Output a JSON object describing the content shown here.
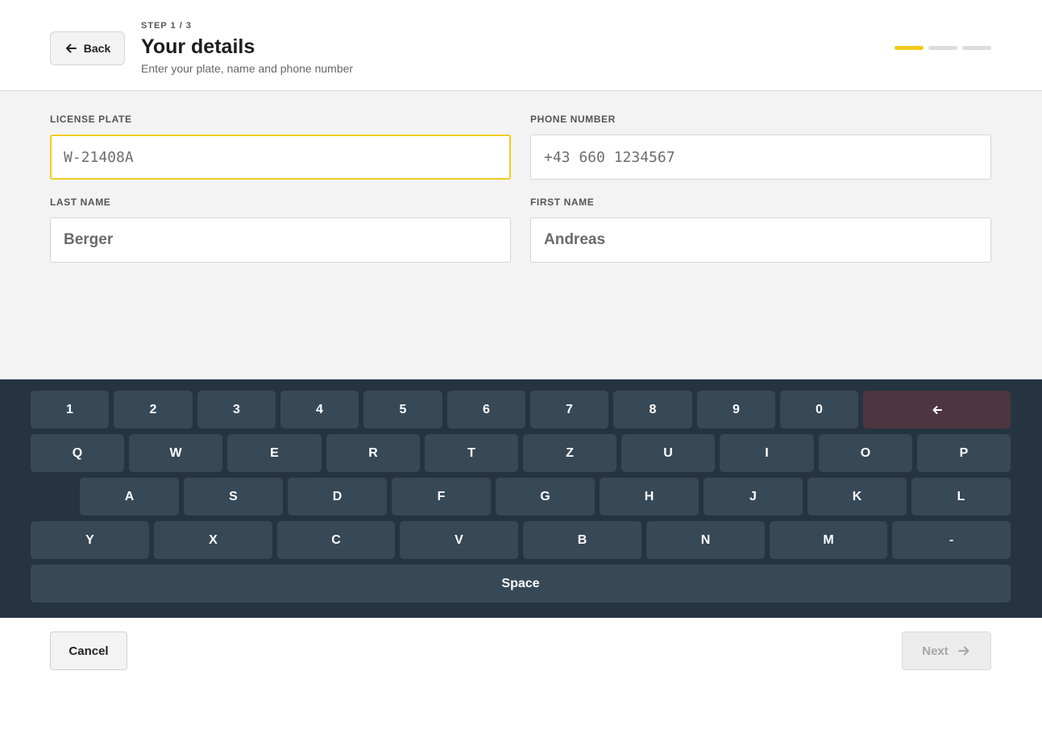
{
  "header": {
    "back_label": "Back",
    "step": "STEP 1 / 3",
    "title": "Your details",
    "subtitle": "Enter your plate, name and phone number",
    "progress": {
      "total_steps": 3,
      "current_step": 1
    }
  },
  "form": {
    "license_plate": {
      "label": "LICENSE PLATE",
      "placeholder": "W-21408A",
      "focused": true
    },
    "phone_number": {
      "label": "PHONE NUMBER",
      "placeholder": "+43 660 1234567"
    },
    "last_name": {
      "label": "LAST NAME",
      "placeholder": "Berger"
    },
    "first_name": {
      "label": "FIRST NAME",
      "placeholder": "Andreas"
    }
  },
  "keyboard": {
    "row1": [
      "1",
      "2",
      "3",
      "4",
      "5",
      "6",
      "7",
      "8",
      "9",
      "0"
    ],
    "row2": [
      "Q",
      "W",
      "E",
      "R",
      "T",
      "Z",
      "U",
      "I",
      "O",
      "P"
    ],
    "row3": [
      "A",
      "S",
      "D",
      "F",
      "G",
      "H",
      "J",
      "K",
      "L"
    ],
    "row4": [
      "Y",
      "X",
      "C",
      "V",
      "B",
      "N",
      "M",
      "-"
    ],
    "space_label": "Space",
    "backspace_icon": "arrow-left-icon"
  },
  "footer": {
    "cancel_label": "Cancel",
    "next_label": "Next",
    "next_enabled": false
  },
  "colors": {
    "accent": "#f0cc1e",
    "keyboard_bg": "#263442",
    "key_bg": "#374856",
    "backspace_bg": "#4d3640"
  }
}
